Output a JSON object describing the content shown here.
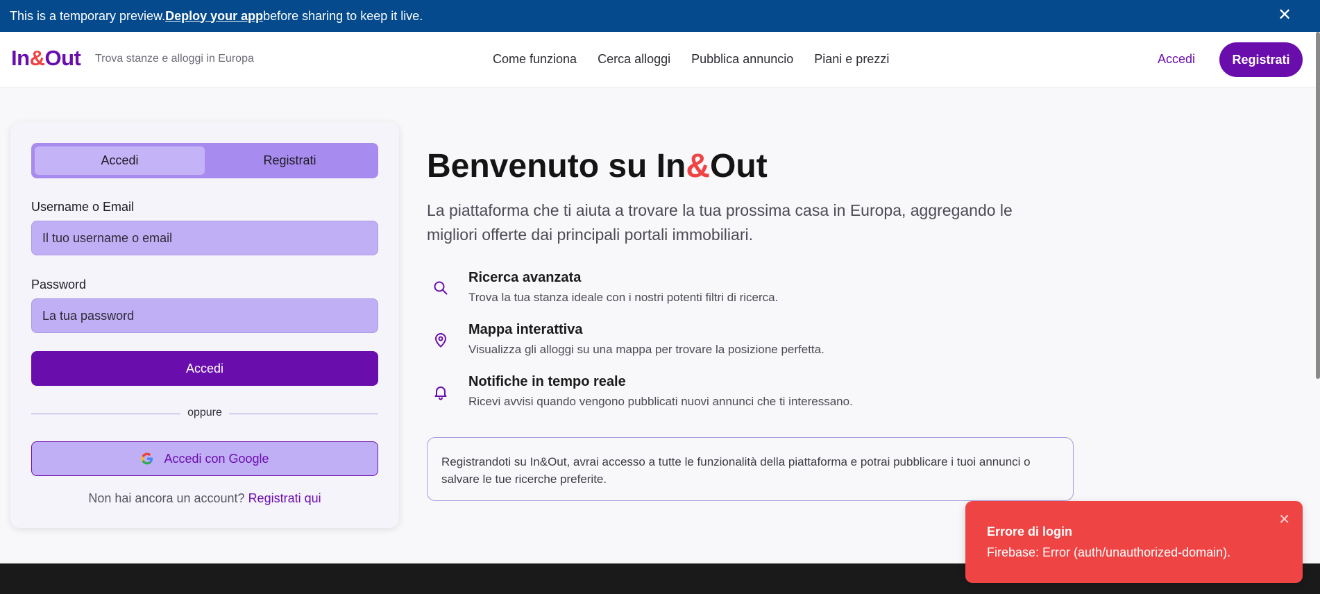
{
  "banner": {
    "text_before": "This is a temporary preview. ",
    "link": "Deploy your app",
    "text_after": " before sharing to keep it live.",
    "close_icon": "close-icon",
    "close_glyph": "✕"
  },
  "header": {
    "logo_in": "In",
    "logo_amp": "&",
    "logo_out": "Out",
    "tagline": "Trova stanze e alloggi in Europa",
    "nav": [
      "Come funziona",
      "Cerca alloggi",
      "Pubblica annuncio",
      "Piani e prezzi"
    ],
    "login": "Accedi",
    "register": "Registrati"
  },
  "auth": {
    "tab_login": "Accedi",
    "tab_register": "Registrati",
    "username_label": "Username o Email",
    "username_placeholder": "Il tuo username o email",
    "password_label": "Password",
    "password_placeholder": "La tua password",
    "submit": "Accedi",
    "divider": "oppure",
    "google": "Accedi con Google",
    "no_account": "Non hai ancora un account?",
    "register_link": "Registrati qui"
  },
  "hero": {
    "title_before": "Benvenuto su In",
    "title_amp": "&",
    "title_after": "Out",
    "subtitle": "La piattaforma che ti aiuta a trovare la tua prossima casa in Europa, aggregando le migliori offerte dai principali portali immobiliari.",
    "features": [
      {
        "icon": "search-icon",
        "title": "Ricerca avanzata",
        "desc": "Trova la tua stanza ideale con i nostri potenti filtri di ricerca."
      },
      {
        "icon": "map-pin-icon",
        "title": "Mappa interattiva",
        "desc": "Visualizza gli alloggi su una mappa per trovare la posizione perfetta."
      },
      {
        "icon": "bell-icon",
        "title": "Notifiche in tempo reale",
        "desc": "Ricevi avvisi quando vengono pubblicati nuovi annunci che ti interessano."
      }
    ],
    "info": "Registrandoti su In&Out, avrai accesso a tutte le funzionalità della piattaforma e potrai pubblicare i tuoi annunci o salvare le tue ricerche preferite."
  },
  "toast": {
    "title": "Errore di login",
    "message": "Firebase: Error (auth/unauthorized-domain).",
    "close_glyph": "✕"
  },
  "colors": {
    "brand": "#6a0dad",
    "accent": "#ef4444",
    "banner": "#044a8d"
  }
}
